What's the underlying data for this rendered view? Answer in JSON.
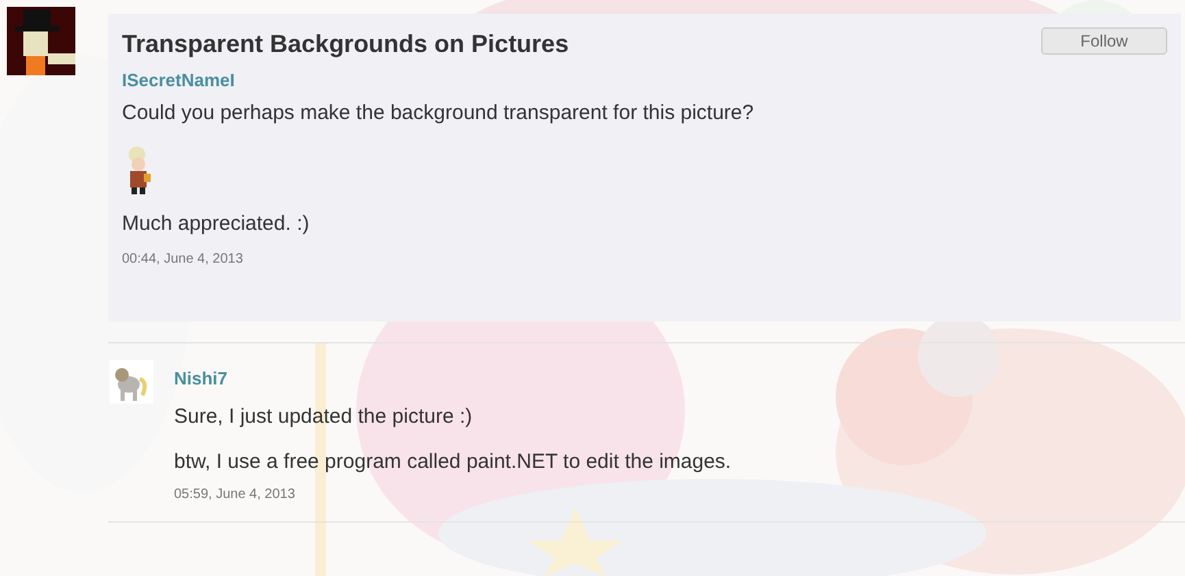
{
  "post": {
    "title": "Transparent Backgrounds on Pictures",
    "author": "ISecretNameI",
    "follow_button": "Follow",
    "paragraphs": [
      {
        "kind": "text",
        "text": "Could you perhaps make the background transparent for this picture?"
      },
      {
        "kind": "picture"
      },
      {
        "kind": "text",
        "text": "Much appreciated. :)"
      }
    ],
    "timestamp": "00:44, June 4, 2013"
  },
  "replies": [
    {
      "author": "Nishi7",
      "paragraphs": [
        {
          "kind": "text",
          "text": "Sure, I just updated the picture :)"
        },
        {
          "kind": "text",
          "text": "btw, I use a free program called paint.NET to edit the images."
        }
      ],
      "timestamp": "05:59, June 4, 2013"
    }
  ]
}
